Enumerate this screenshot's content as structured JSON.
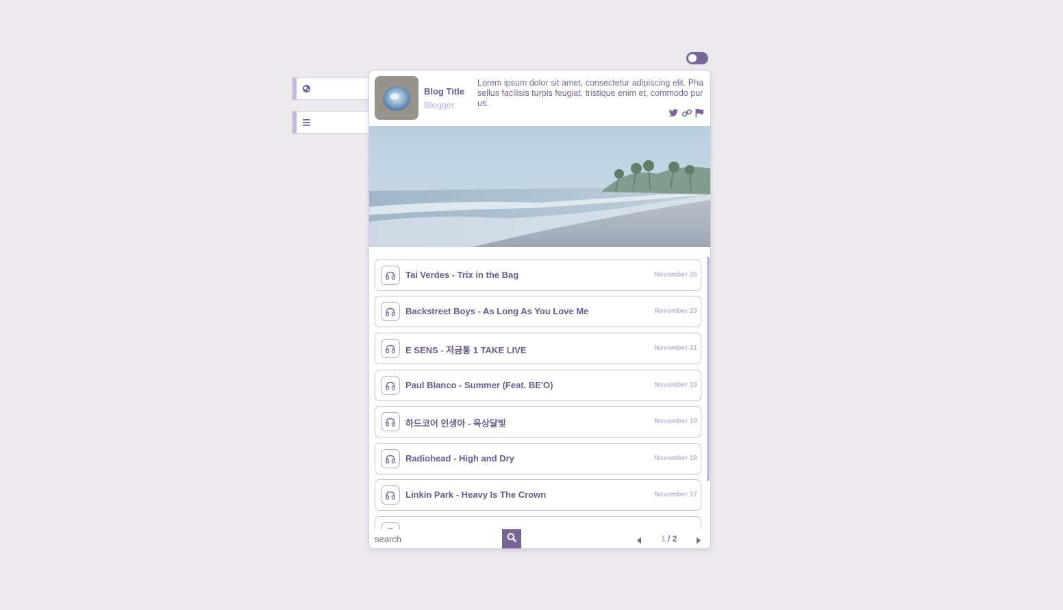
{
  "header": {
    "blog_title": "Blog Title",
    "blog_subtitle": "Blogger",
    "description": "Lorem ipsum dolor sit amet, consectetur adipiscing elit. Phasellus facilisis turpis feugiat, tristique enim et, commodo purus."
  },
  "side_tabs": [
    {
      "icon": "globe-icon"
    },
    {
      "icon": "menu-icon"
    }
  ],
  "social_icons": [
    "twitter-icon",
    "link-icon",
    "flag-icon"
  ],
  "posts": [
    {
      "title": "Tai Verdes - Trix in the Bag",
      "date": "November 26"
    },
    {
      "title": "Backstreet Boys - As Long As You Love Me",
      "date": "November 23"
    },
    {
      "title": "E SENS - 저금통 1 TAKE LIVE",
      "date": "November 21"
    },
    {
      "title": "Paul Blanco - Summer (Feat. BE'O)",
      "date": "November 20"
    },
    {
      "title": "하드코어 인생아 - 옥상달빛",
      "date": "November 19"
    },
    {
      "title": "Radiohead - High and Dry",
      "date": "November 18"
    },
    {
      "title": "Linkin Park - Heavy Is The Crown",
      "date": "November 17"
    }
  ],
  "footer": {
    "search_placeholder": "search",
    "page_current": "1",
    "page_separator_total": " / 2"
  },
  "colors": {
    "accent": "#7a6696",
    "accent_light": "#c8b4e0",
    "background": "#ece9ee"
  }
}
